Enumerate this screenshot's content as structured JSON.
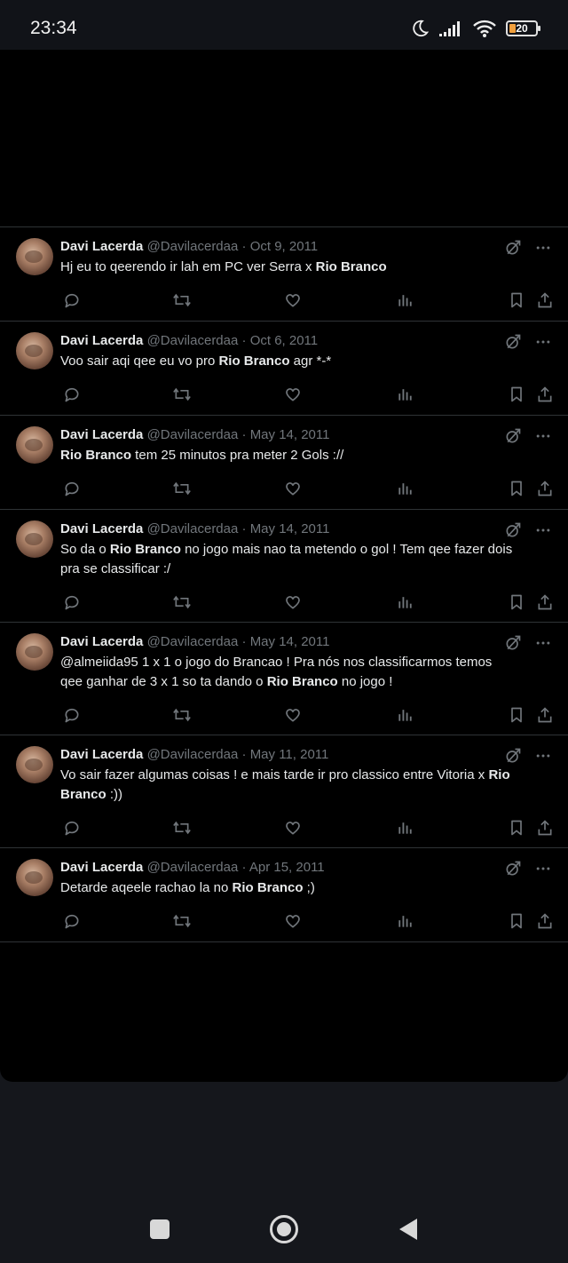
{
  "status": {
    "time": "23:34",
    "battery": "20"
  },
  "tweets": [
    {
      "name": "Davi Lacerda",
      "handle": "@Davilacerdaa",
      "sep": "·",
      "date": "Oct 9, 2011",
      "lines": [
        [
          {
            "t": "Hj eu to qeerendo ir lah em PC ver Serra x ",
            "b": false
          },
          {
            "t": "Rio Branco",
            "b": true
          }
        ]
      ]
    },
    {
      "name": "Davi Lacerda",
      "handle": "@Davilacerdaa",
      "sep": "·",
      "date": "Oct 6, 2011",
      "lines": [
        [
          {
            "t": "Voo sair aqi qee eu vo pro ",
            "b": false
          },
          {
            "t": "Rio Branco",
            "b": true
          },
          {
            "t": " agr *-*",
            "b": false
          }
        ]
      ]
    },
    {
      "name": "Davi Lacerda",
      "handle": "@Davilacerdaa",
      "sep": "·",
      "date": "May 14, 2011",
      "lines": [
        [
          {
            "t": "Rio Branco",
            "b": true
          },
          {
            "t": " tem 25 minutos pra meter 2 Gols ://",
            "b": false
          }
        ]
      ]
    },
    {
      "name": "Davi Lacerda",
      "handle": "@Davilacerdaa",
      "sep": "·",
      "date": "May 14, 2011",
      "lines": [
        [
          {
            "t": "So da o ",
            "b": false
          },
          {
            "t": "Rio Branco",
            "b": true
          },
          {
            "t": " no jogo mais nao ta metendo o gol ! Tem qee fazer dois",
            "b": false
          }
        ],
        [
          {
            "t": "pra se classificar :/",
            "b": false
          }
        ]
      ]
    },
    {
      "name": "Davi Lacerda",
      "handle": "@Davilacerdaa",
      "sep": "·",
      "date": "May 14, 2011",
      "lines": [
        [
          {
            "t": "@almeiida95 1 x 1 o jogo do Brancao ! Pra nós nos classificarmos temos",
            "b": false
          }
        ],
        [
          {
            "t": "qee ganhar de 3 x 1 so ta dando o ",
            "b": false
          },
          {
            "t": "Rio Branco",
            "b": true
          },
          {
            "t": " no jogo !",
            "b": false
          }
        ]
      ]
    },
    {
      "name": "Davi Lacerda",
      "handle": "@Davilacerdaa",
      "sep": "·",
      "date": "May 11, 2011",
      "lines": [
        [
          {
            "t": "Vo sair fazer algumas coisas ! e mais tarde ir pro classico entre Vitoria x ",
            "b": false
          },
          {
            "t": "Rio",
            "b": true
          }
        ],
        [
          {
            "t": "Branco",
            "b": true
          },
          {
            "t": " :))",
            "b": false
          }
        ]
      ]
    },
    {
      "name": "Davi Lacerda",
      "handle": "@Davilacerdaa",
      "sep": "·",
      "date": "Apr 15, 2011",
      "lines": [
        [
          {
            "t": "Detarde aqeele rachao la no ",
            "b": false
          },
          {
            "t": "Rio Branco",
            "b": true
          },
          {
            "t": " ;)",
            "b": false
          }
        ]
      ]
    }
  ],
  "icons": {
    "tweet_top": [
      "grok-icon",
      "more-icon"
    ],
    "actions": [
      "reply-icon",
      "retweet-icon",
      "like-icon",
      "views-icon",
      "bookmark-icon",
      "share-icon"
    ],
    "nav": [
      "recents-square-icon",
      "home-circle-icon",
      "back-triangle-icon"
    ]
  }
}
